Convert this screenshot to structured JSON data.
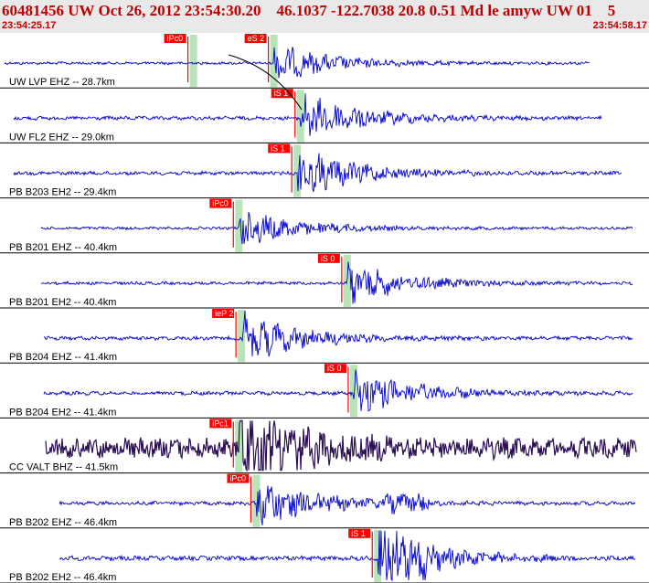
{
  "header": {
    "title": "60481456 UW Oct 26, 2012 23:54:30.20    46.1037 -122.7038 20.8 0.51 Md le amyw UW 01    5",
    "start_time": "23:54:25.17",
    "end_time": "23:54:58.17"
  },
  "colors": {
    "trace": "#0000c8",
    "trace_noisy": "#2b0e55",
    "pick_flag": "#ff0000",
    "pick_band": "#b9e4b9",
    "separator": "#000000",
    "header_bg": "#e9e9e9",
    "header_text": "#c00000"
  },
  "channels": [
    {
      "label": "UW LVP EHZ -- 28.7km",
      "picks": [
        {
          "text": "iPc0",
          "band_pos": 0.298
        },
        {
          "text": "eS 2",
          "band_pos": 0.422
        }
      ],
      "amp": 1.0
    },
    {
      "label": "UW FL2 EHZ -- 29.0km",
      "picks": [
        {
          "text": "iS 1",
          "band_pos": 0.463
        }
      ],
      "amp": 1.3
    },
    {
      "label": "PB B203 EH2 -- 29.4km",
      "picks": [
        {
          "text": "iS 1",
          "band_pos": 0.458
        }
      ],
      "amp": 1.3
    },
    {
      "label": "PB B201 EHZ -- 40.4km",
      "picks": [
        {
          "text": "iPc0",
          "band_pos": 0.368
        }
      ],
      "amp": 1.0
    },
    {
      "label": "PB B201 EH2 -- 40.4km",
      "picks": [
        {
          "text": "iS 0",
          "band_pos": 0.535
        }
      ],
      "amp": 1.1
    },
    {
      "label": "PB B204 EHZ -- 41.4km",
      "picks": [
        {
          "text": "ieP 2",
          "band_pos": 0.372
        }
      ],
      "amp": 1.3
    },
    {
      "label": "PB B204 EH2 -- 41.4km",
      "picks": [
        {
          "text": "iS 0",
          "band_pos": 0.545
        }
      ],
      "amp": 1.3
    },
    {
      "label": "CC VALT BHZ -- 41.5km",
      "picks": [
        {
          "text": "iPc1",
          "band_pos": 0.368
        }
      ],
      "amp": 2.2
    },
    {
      "label": "PB B202 EHZ -- 46.4km",
      "picks": [
        {
          "text": "iPc0",
          "band_pos": 0.395
        }
      ],
      "amp": 1.3
    },
    {
      "label": "PB B202 EH2 -- 46.4km",
      "picks": [
        {
          "text": "iS 1",
          "band_pos": 0.582
        }
      ],
      "amp": 1.6
    }
  ]
}
